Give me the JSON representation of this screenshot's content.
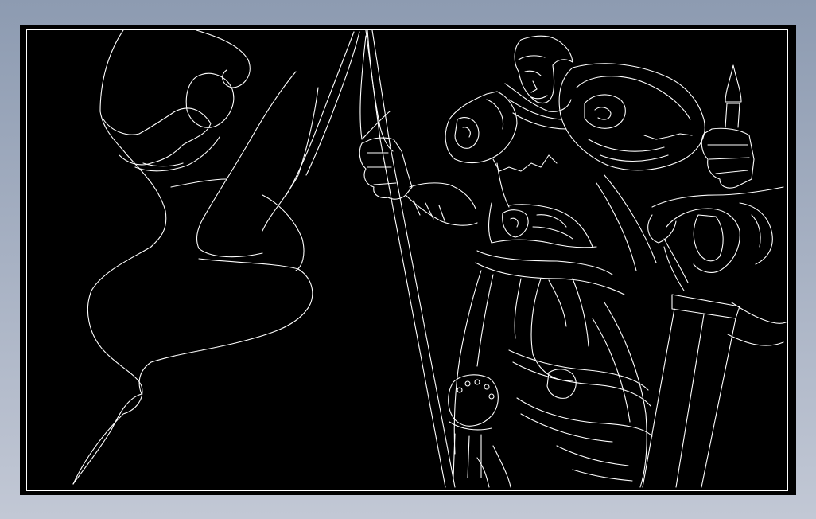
{
  "viewport": {
    "background_top": "#8d9bb1",
    "background_bottom": "#c2c8d5"
  },
  "model_space": {
    "background": "#000000",
    "line_color": "#ffffff"
  },
  "drawing": {
    "entities": [
      "hooded-figure-outline",
      "banner-spear",
      "banner-flag",
      "warrior-head",
      "left-shoulder-pauldron",
      "right-shoulder-pauldron",
      "raised-fist",
      "gripping-hand",
      "sword-crossguard",
      "sword-blade",
      "armored-torso",
      "armored-skirt",
      "knee-guard"
    ]
  }
}
